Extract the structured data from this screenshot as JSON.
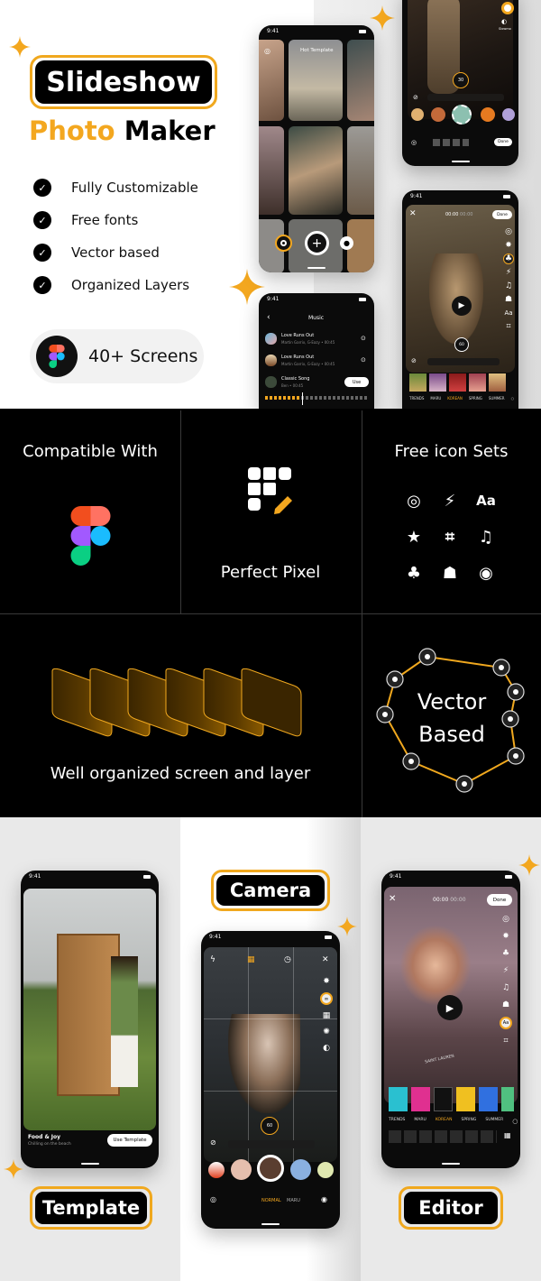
{
  "hero": {
    "title": "Slideshow",
    "subtitle_accent": "Photo",
    "subtitle_rest": "Maker",
    "features": [
      "Fully Customizable",
      "Free fonts",
      "Vector based",
      "Organized Layers"
    ],
    "screens_label": "40+ Screens",
    "accent_color": "#f3a71f"
  },
  "phones": {
    "home": {
      "time": "9:41",
      "header": "Hot Template"
    },
    "music": {
      "time": "9:41",
      "title": "Music",
      "tracks": [
        {
          "name": "Love Runs Out",
          "meta": "Martin Garrix, G-Eazy • 00:45"
        },
        {
          "name": "Love Runs Out",
          "meta": "Martin Garrix, G-Eazy • 00:45"
        },
        {
          "name": "Classic Song",
          "meta": "Ben • 00:45"
        }
      ],
      "use_label": "Use"
    },
    "top_editor": {
      "dial_value": "30",
      "done_label": "Done",
      "side_label": "Slowmo"
    },
    "video_editor": {
      "time": "9:41",
      "timer": "00:00",
      "timer_total": "00:00",
      "done_label": "Done",
      "dial_value": "60",
      "rail": [
        "Adjust",
        "Effect",
        "Filter",
        "Transition",
        "Music",
        "Sticker",
        "Text",
        "Canvas"
      ],
      "categories": [
        "TRENDS",
        "MARU",
        "KOREAN",
        "SPRING",
        "SUMMER"
      ],
      "active_category": "KOREAN"
    }
  },
  "features_grid": {
    "compatible": "Compatible With",
    "pixel": "Perfect Pixel",
    "icons_title": "Free icon Sets",
    "icons": [
      "adjust-icon",
      "transition-icon",
      "text-icon",
      "effect-icon",
      "crop-icon",
      "music-icon",
      "filter-icon",
      "sticker-icon",
      "slowmo-icon"
    ],
    "layers": "Well organized screen and layer",
    "vector_line1": "Vector",
    "vector_line2": "Based"
  },
  "bottom": {
    "template": {
      "time": "9:41",
      "card_title": "Food & Joy",
      "card_sub": "Chilling on the beach",
      "use_label": "Use Template",
      "label": "Template"
    },
    "camera": {
      "label": "Camera",
      "time": "9:41",
      "dial_value": "60",
      "rail": [
        "Effect",
        "Collage",
        "Slideshow",
        "Slowmo"
      ],
      "modes": [
        "NORMAL",
        "MARU"
      ],
      "active_mode": "NORMAL"
    },
    "editor": {
      "label": "Editor",
      "time": "9:41",
      "timer": "00:00",
      "timer_total": "00:00",
      "done_label": "Done",
      "rail": [
        "Adjust",
        "Effect",
        "Filter",
        "Transition",
        "Music",
        "Sticker",
        "Text",
        "Canvas"
      ],
      "categories": [
        "TRENDS",
        "MARU",
        "KOREAN",
        "SPRING",
        "SUMMER"
      ],
      "active_category": "KOREAN",
      "watermark": "SAINT LAUREN"
    }
  }
}
